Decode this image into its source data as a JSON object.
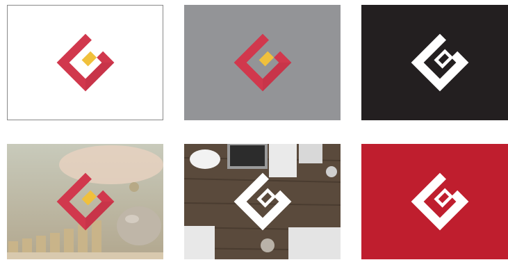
{
  "colors": {
    "white_bg": "#ffffff",
    "border": "#888888",
    "gray_bg": "#939497",
    "black_bg": "#231f20",
    "red_bg": "#bf1e2e",
    "logo_red": "#d1384d",
    "logo_red_dark": "#b82d42",
    "logo_yellow": "#f0c03c",
    "logo_white": "#ffffff"
  },
  "tiles": [
    {
      "name": "logo-on-white",
      "background": "white",
      "logo_variant": "color"
    },
    {
      "name": "logo-on-gray",
      "background": "gray",
      "logo_variant": "color"
    },
    {
      "name": "logo-on-black",
      "background": "black",
      "logo_variant": "white"
    },
    {
      "name": "logo-on-savings-photo",
      "background": "photo-coins-piggybank",
      "logo_variant": "color"
    },
    {
      "name": "logo-on-desk-photo",
      "background": "photo-office-desk",
      "logo_variant": "white"
    },
    {
      "name": "logo-on-red",
      "background": "red",
      "logo_variant": "white"
    }
  ]
}
